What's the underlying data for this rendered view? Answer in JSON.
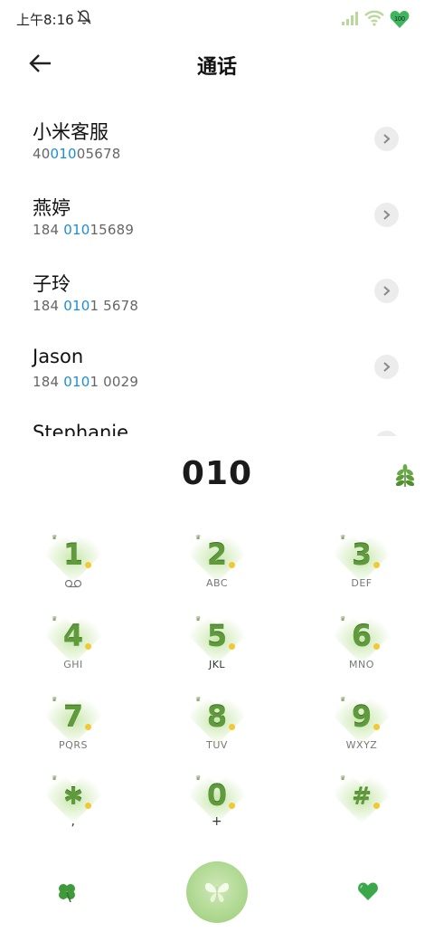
{
  "status_bar": {
    "time": "上午8:16",
    "battery": "100"
  },
  "header": {
    "title": "通话"
  },
  "contacts": [
    {
      "name": "小米客服",
      "num_pre": "40",
      "num_hl": "010",
      "num_post": "05678"
    },
    {
      "name": "燕婷",
      "num_pre": "184 ",
      "num_hl": "010",
      "num_post": "15689"
    },
    {
      "name": "子玲",
      "num_pre": "184 ",
      "num_hl": "010",
      "num_post": "1 5678"
    },
    {
      "name": "Jason",
      "num_pre": "184 ",
      "num_hl": "010",
      "num_post": "1 0029"
    },
    {
      "name": "Stephanie",
      "num_pre": "",
      "num_hl": "",
      "num_post": ""
    }
  ],
  "dialed_number": "010",
  "keypad": [
    {
      "digit": "1",
      "letters": ""
    },
    {
      "digit": "2",
      "letters": "ABC"
    },
    {
      "digit": "3",
      "letters": "DEF"
    },
    {
      "digit": "4",
      "letters": "GHI"
    },
    {
      "digit": "5",
      "letters": "JKL"
    },
    {
      "digit": "6",
      "letters": "MNO"
    },
    {
      "digit": "7",
      "letters": "PQRS"
    },
    {
      "digit": "8",
      "letters": "TUV"
    },
    {
      "digit": "9",
      "letters": "WXYZ"
    },
    {
      "digit": "✱",
      "letters": ","
    },
    {
      "digit": "0",
      "letters": "+"
    },
    {
      "digit": "#",
      "letters": ""
    }
  ],
  "icons": {
    "back": "back-arrow-icon",
    "mute": "bell-muted-icon",
    "signal": "signal-icon",
    "wifi": "wifi-icon",
    "battery": "battery-heart-icon",
    "chevron": "chevron-right-icon",
    "dialpad_toggle": "leaf-icon",
    "voicemail": "voicemail-icon",
    "bottom_left": "clover-icon",
    "call": "butterfly-icon",
    "bottom_right": "heart-icon"
  },
  "colors": {
    "accent": "#1a8fd6",
    "theme_green": "#5f9a3c",
    "heart_glow": "#c6e6a8",
    "call_button": "#a9d58a"
  }
}
